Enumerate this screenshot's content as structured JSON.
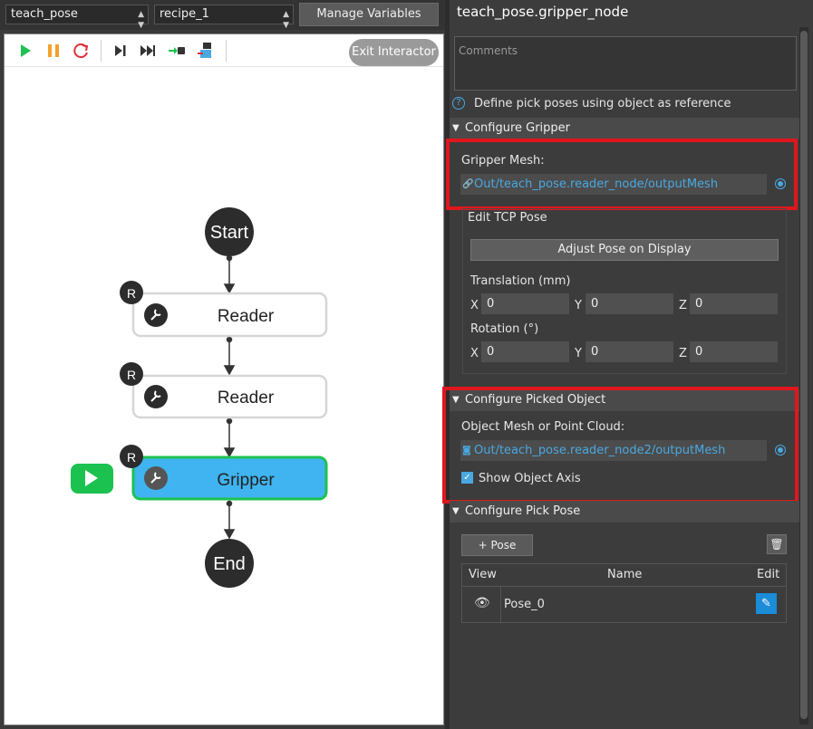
{
  "topbar": {
    "project_select": "teach_pose",
    "recipe_select": "recipe_1",
    "manage_label": "Manage Variables"
  },
  "canvas": {
    "exit_label": "Exit Interactor",
    "toolbar_icons": [
      "play-icon",
      "pause-icon",
      "restart-icon",
      "step-icon",
      "fast-forward-icon",
      "step-into-icon",
      "debug-icon"
    ],
    "nodes": {
      "start": "Start",
      "reader1": "Reader",
      "reader2": "Reader",
      "gripper": "Gripper",
      "end": "End",
      "badge": "R"
    }
  },
  "panel": {
    "title": "teach_pose.gripper_node",
    "comments_placeholder": "Comments",
    "help_text": "Define pick poses using object as reference",
    "configure_gripper": {
      "header": "Configure Gripper",
      "mesh_label": "Gripper Mesh:",
      "mesh_value": "Out/teach_pose.reader_node/outputMesh",
      "edit_tcp": "Edit TCP Pose",
      "adjust_btn": "Adjust Pose on Display",
      "translation_label": "Translation (mm)",
      "rotation_label": "Rotation (°)",
      "x": "X",
      "y": "Y",
      "z": "Z",
      "tx": "0",
      "ty": "0",
      "tz": "0",
      "rx": "0",
      "ry": "0",
      "rz": "0"
    },
    "configure_object": {
      "header": "Configure Picked Object",
      "mesh_label": "Object Mesh or Point Cloud:",
      "mesh_value": "Out/teach_pose.reader_node2/outputMesh",
      "show_axis": "Show Object Axis"
    },
    "configure_pick": {
      "header": "Configure Pick Pose",
      "add_pose": "+ Pose",
      "col_view": "View",
      "col_name": "Name",
      "col_edit": "Edit",
      "pose_name": "Pose_0"
    }
  },
  "colors": {
    "accent": "#4aa8e0",
    "active_node": "#3fb4f0",
    "active_border": "#1cc250",
    "play_green": "#1cc250",
    "highlight_red": "#e0161e"
  }
}
